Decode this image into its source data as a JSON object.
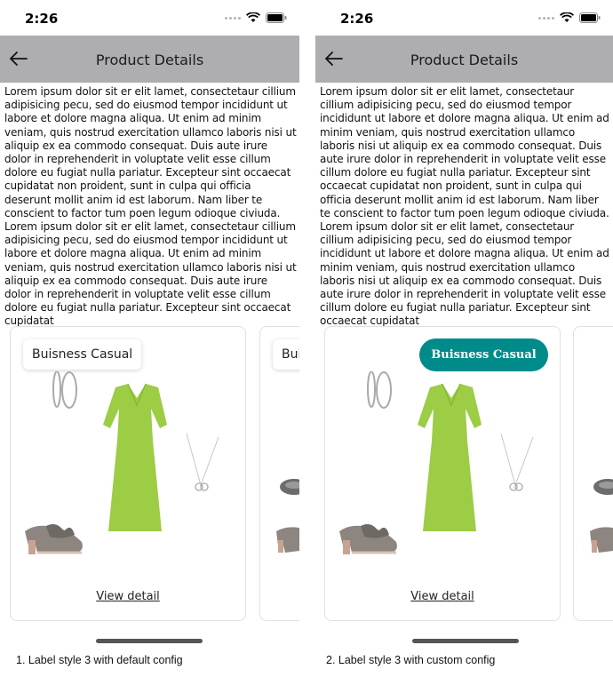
{
  "status": {
    "time": "2:26"
  },
  "nav": {
    "title": "Product Details"
  },
  "description": "Lorem ipsum dolor sit er elit lamet, consectetaur cillium adipisicing pecu, sed do eiusmod tempor incididunt ut labore et dolore magna aliqua. Ut enim ad minim veniam, quis nostrud exercitation ullamco laboris nisi ut aliquip ex ea commodo consequat. Duis aute irure dolor in reprehenderit in voluptate velit esse cillum dolore eu fugiat nulla pariatur. Excepteur sint occaecat cupidatat non proident, sunt in culpa qui officia deserunt mollit anim id est laborum. Nam liber te conscient to factor tum poen legum odioque civiuda. Lorem ipsum dolor sit er elit lamet, consectetaur cillium adipisicing pecu, sed do eiusmod tempor incididunt ut labore et dolore magna aliqua. Ut enim ad minim veniam, quis nostrud exercitation ullamco laboris nisi ut aliquip ex ea commodo consequat. Duis aute irure dolor in reprehenderit in voluptate velit esse cillum dolore eu fugiat nulla pariatur. Excepteur sint occaecat cupidatat",
  "card": {
    "label": "Buisness Casual",
    "stub_label": "Bui",
    "view_detail": "View detail"
  },
  "captions": {
    "left": "1. Label style 3 with default config",
    "right": "2. Label style 3 with custom config"
  },
  "colors": {
    "nav_bg": "#adadb2",
    "custom_label_bg": "#008b8b",
    "dress": "#9dcc45"
  },
  "icons": [
    "back-arrow-icon",
    "wifi-icon",
    "battery-icon",
    "signal-dots-icon"
  ]
}
